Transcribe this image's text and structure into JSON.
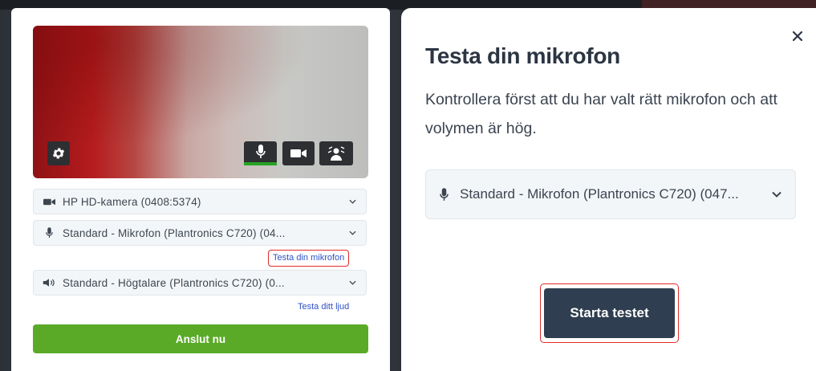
{
  "preview": {
    "camera_select": {
      "label": "HP HD-kamera (0408:5374)",
      "icon": "video-camera-icon"
    },
    "mic_select": {
      "label": "Standard - Mikrofon (Plantronics C720) (04...",
      "icon": "microphone-icon"
    },
    "test_mic_link": "Testa din mikrofon",
    "speaker_select": {
      "label": "Standard - Högtalare (Plantronics C720) (0...",
      "icon": "speaker-icon"
    },
    "test_sound_link": "Testa ditt ljud",
    "connect_button": "Anslut nu",
    "mic_active_color": "#26a324"
  },
  "dialog": {
    "title": "Testa din mikrofon",
    "description": "Kontrollera först att du har valt rätt mikrofon och att volymen är hög.",
    "mic_select": {
      "label": "Standard - Mikrofon (Plantronics C720) (047...",
      "icon": "microphone-icon"
    },
    "start_button": "Starta testet",
    "close_icon": "close-icon"
  },
  "colors": {
    "connect_green": "#5aaa27",
    "start_button_bg": "#2f3e50",
    "highlight_red": "#e22a2a",
    "link_blue": "#2f52c6"
  }
}
